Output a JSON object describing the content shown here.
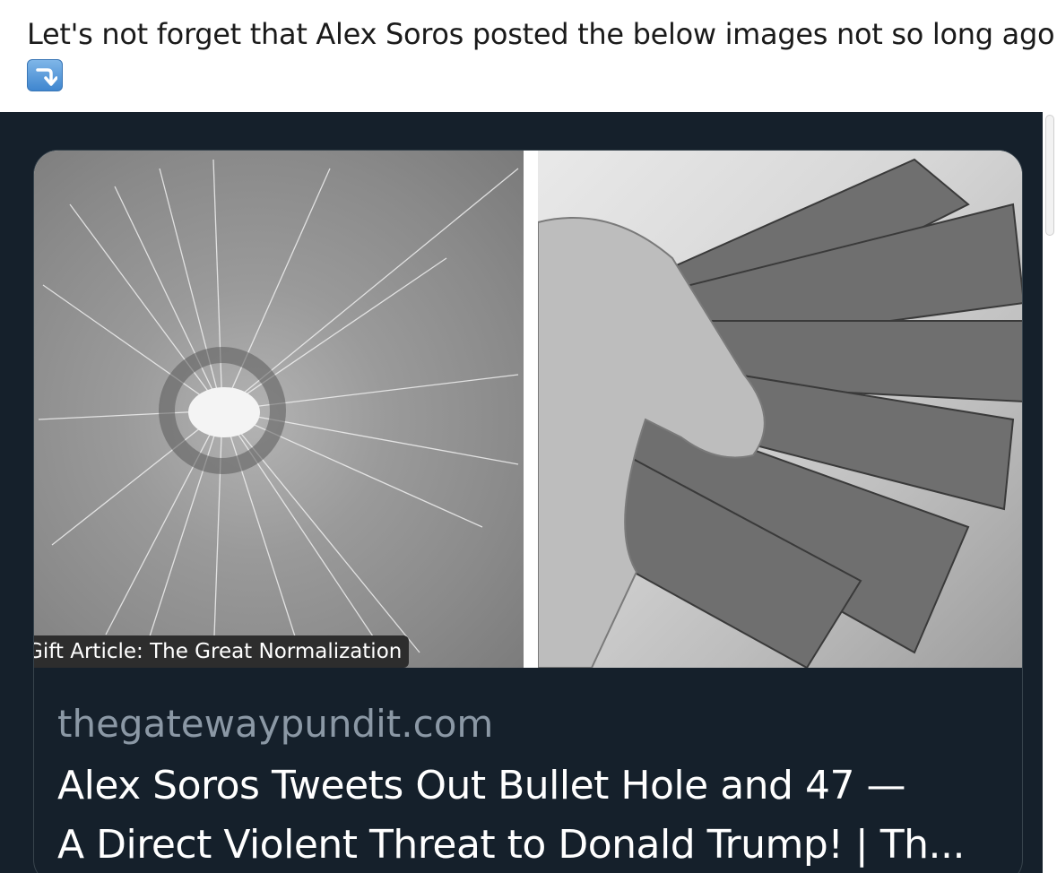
{
  "post": {
    "text": "Let's not forget that Alex Soros posted the below images not so long ago",
    "emoji": "⤵"
  },
  "link_card": {
    "image_caption": "Gift Article: The Great Normalization",
    "domain": "thegatewaypundit.com",
    "title_line1": "Alex Soros Tweets Out Bullet Hole and 47 —",
    "title_line2": "A Direct Violent Threat to Donald Trump! | Th..."
  },
  "colors": {
    "background_dark": "#15202b",
    "domain_text": "#8b98a5",
    "title_text": "#ffffff",
    "card_border": "#38444d"
  }
}
